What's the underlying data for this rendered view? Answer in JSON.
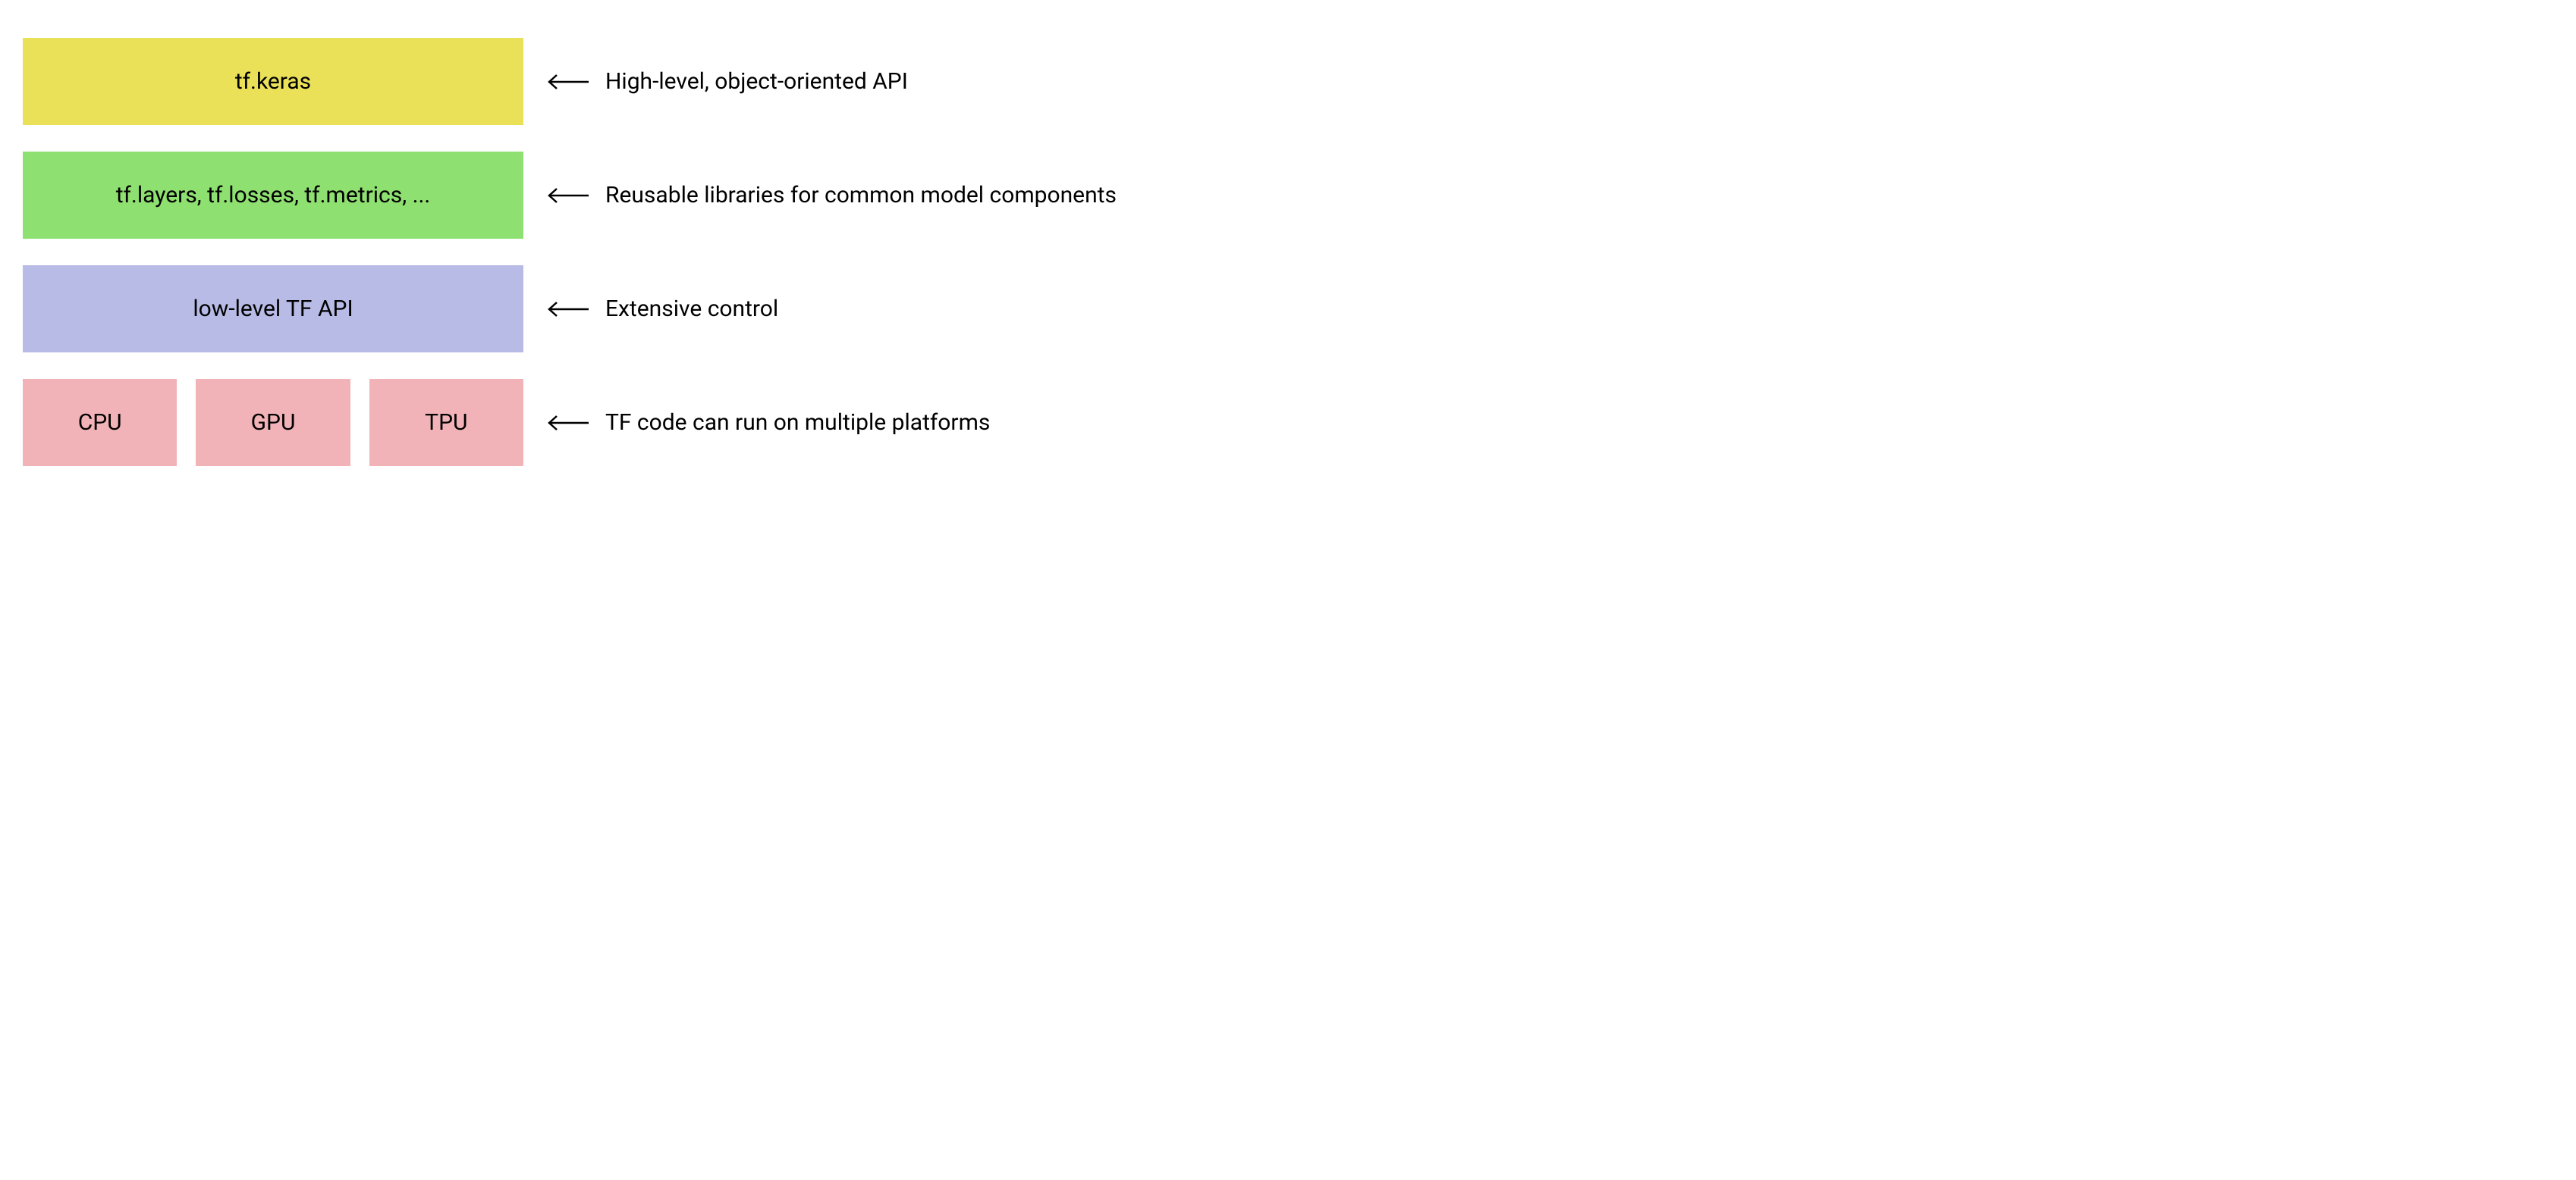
{
  "layers": [
    {
      "id": "keras",
      "label": "tf.keras",
      "color": "yellow",
      "annotation": "High-level, object-oriented API"
    },
    {
      "id": "libs",
      "label": "tf.layers, tf.losses, tf.metrics, ...",
      "color": "green",
      "annotation": "Reusable libraries for common model components"
    },
    {
      "id": "lowlevel",
      "label": "low-level TF API",
      "color": "blue",
      "annotation": "Extensive control"
    }
  ],
  "platforms": {
    "items": [
      {
        "label": "CPU"
      },
      {
        "label": "GPU"
      },
      {
        "label": "TPU"
      }
    ],
    "annotation": "TF code can run on multiple platforms"
  }
}
